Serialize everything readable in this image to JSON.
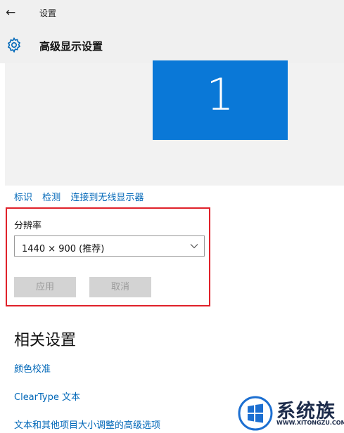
{
  "window": {
    "back_glyph": "←",
    "title": "设置"
  },
  "page": {
    "title": "高级显示设置"
  },
  "preview": {
    "monitor_number": "1"
  },
  "links": [
    "标识",
    "检测",
    "连接到无线显示器"
  ],
  "resolution": {
    "label": "分辨率",
    "selected": "1440 × 900 (推荐)",
    "apply_label": "应用",
    "cancel_label": "取消"
  },
  "related": {
    "title": "相关设置",
    "links": [
      "颜色校准",
      "ClearType 文本",
      "文本和其他项目大小调整的高级选项"
    ]
  },
  "watermark": {
    "text": "系统族",
    "url": "WWW.XITONGZU.COM"
  },
  "colors": {
    "accent": "#0067b8",
    "monitor": "#0a78d7",
    "highlight_border": "#e0212a",
    "disabled_button": "#d3d3d3"
  }
}
